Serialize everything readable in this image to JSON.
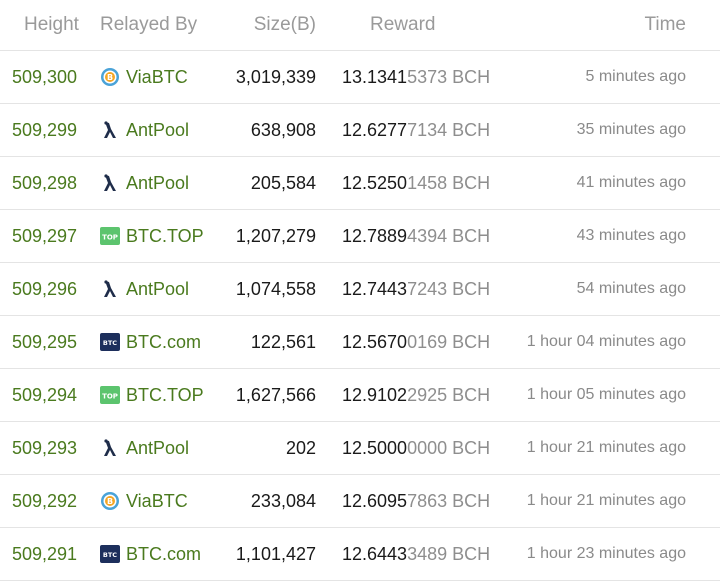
{
  "headers": {
    "height": "Height",
    "relayed": "Relayed By",
    "size": "Size(B)",
    "reward": "Reward",
    "time": "Time"
  },
  "colors": {
    "link_green": "#4a7a1e",
    "gray": "#8e8e8e",
    "divider": "#e4e4e4"
  },
  "rows": [
    {
      "height": "509,300",
      "pool": "ViaBTC",
      "icon": "viabtc-icon",
      "size": "3,019,339",
      "reward_main": "13.1341",
      "reward_rest": "5373 BCH",
      "time": "5 minutes ago"
    },
    {
      "height": "509,299",
      "pool": "AntPool",
      "icon": "antpool-icon",
      "size": "638,908",
      "reward_main": "12.6277",
      "reward_rest": "7134 BCH",
      "time": "35 minutes ago"
    },
    {
      "height": "509,298",
      "pool": "AntPool",
      "icon": "antpool-icon",
      "size": "205,584",
      "reward_main": "12.5250",
      "reward_rest": "1458 BCH",
      "time": "41 minutes ago"
    },
    {
      "height": "509,297",
      "pool": "BTC.TOP",
      "icon": "btctop-icon",
      "size": "1,207,279",
      "reward_main": "12.7889",
      "reward_rest": "4394 BCH",
      "time": "43 minutes ago"
    },
    {
      "height": "509,296",
      "pool": "AntPool",
      "icon": "antpool-icon",
      "size": "1,074,558",
      "reward_main": "12.7443",
      "reward_rest": "7243 BCH",
      "time": "54 minutes ago"
    },
    {
      "height": "509,295",
      "pool": "BTC.com",
      "icon": "btccom-icon",
      "size": "122,561",
      "reward_main": "12.5670",
      "reward_rest": "0169 BCH",
      "time": "1 hour 04 minutes ago"
    },
    {
      "height": "509,294",
      "pool": "BTC.TOP",
      "icon": "btctop-icon",
      "size": "1,627,566",
      "reward_main": "12.9102",
      "reward_rest": "2925 BCH",
      "time": "1 hour 05 minutes ago"
    },
    {
      "height": "509,293",
      "pool": "AntPool",
      "icon": "antpool-icon",
      "size": "202",
      "reward_main": "12.5000",
      "reward_rest": "0000 BCH",
      "time": "1 hour 21 minutes ago"
    },
    {
      "height": "509,292",
      "pool": "ViaBTC",
      "icon": "viabtc-icon",
      "size": "233,084",
      "reward_main": "12.6095",
      "reward_rest": "7863 BCH",
      "time": "1 hour 21 minutes ago"
    },
    {
      "height": "509,291",
      "pool": "BTC.com",
      "icon": "btccom-icon",
      "size": "1,101,427",
      "reward_main": "12.6443",
      "reward_rest": "3489 BCH",
      "time": "1 hour 23 minutes ago"
    }
  ]
}
